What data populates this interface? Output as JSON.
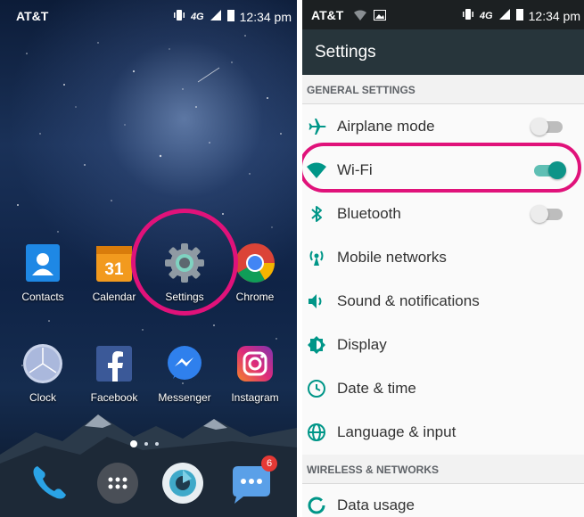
{
  "home": {
    "status": {
      "carrier": "AT&T",
      "time": "12:34 pm"
    },
    "apps_row1": [
      {
        "label": "Contacts",
        "icon": "contacts-icon"
      },
      {
        "label": "Calendar",
        "icon": "calendar-icon",
        "badge_text": "31"
      },
      {
        "label": "Settings",
        "icon": "gear-icon"
      },
      {
        "label": "Chrome",
        "icon": "chrome-icon"
      }
    ],
    "apps_row2": [
      {
        "label": "Clock",
        "icon": "clock-icon"
      },
      {
        "label": "Facebook",
        "icon": "facebook-icon"
      },
      {
        "label": "Messenger",
        "icon": "messenger-icon"
      },
      {
        "label": "Instagram",
        "icon": "instagram-icon"
      }
    ],
    "dock": [
      {
        "icon": "phone-icon"
      },
      {
        "icon": "app-drawer-icon"
      },
      {
        "icon": "camera-icon"
      },
      {
        "icon": "messages-icon",
        "badge": "6"
      }
    ],
    "highlight_color": "#e0127a"
  },
  "settings": {
    "status": {
      "carrier": "AT&T",
      "time": "12:34 pm"
    },
    "title": "Settings",
    "sections": {
      "general": "GENERAL SETTINGS",
      "wireless": "WIRELESS & NETWORKS"
    },
    "items": [
      {
        "label": "Airplane mode",
        "icon": "airplane-icon",
        "toggle": "off"
      },
      {
        "label": "Wi-Fi",
        "icon": "wifi-icon",
        "toggle": "on"
      },
      {
        "label": "Bluetooth",
        "icon": "bluetooth-icon",
        "toggle": "off"
      },
      {
        "label": "Mobile networks",
        "icon": "antenna-icon"
      },
      {
        "label": "Sound & notifications",
        "icon": "volume-icon"
      },
      {
        "label": "Display",
        "icon": "brightness-icon"
      },
      {
        "label": "Date & time",
        "icon": "clock-icon"
      },
      {
        "label": "Language & input",
        "icon": "globe-icon"
      },
      {
        "label": "Data usage",
        "icon": "data-usage-icon"
      }
    ],
    "accent_color": "#0d9488"
  }
}
